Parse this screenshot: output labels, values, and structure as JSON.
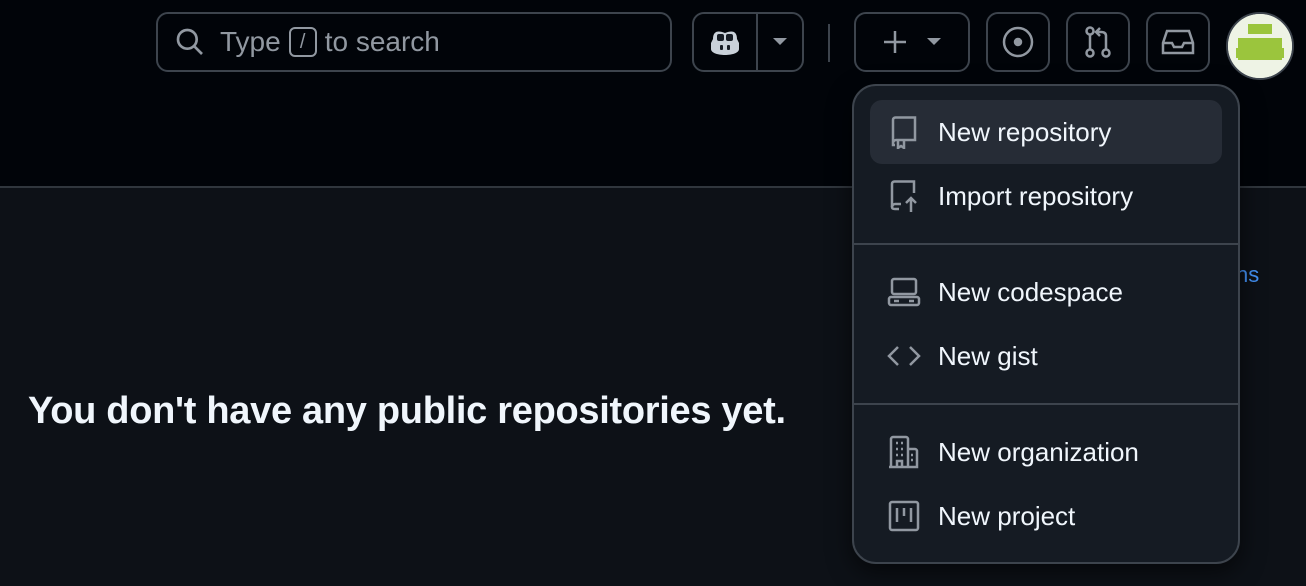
{
  "header": {
    "search": {
      "prefix": "Type",
      "key": "/",
      "suffix": "to search"
    }
  },
  "main": {
    "empty_message": "You don't have any public repositories yet.",
    "partial_link": "ns"
  },
  "create_menu": {
    "items": [
      {
        "label": "New repository",
        "icon": "repo-icon"
      },
      {
        "label": "Import repository",
        "icon": "repo-push-icon"
      },
      {
        "label": "New codespace",
        "icon": "codespace-icon"
      },
      {
        "label": "New gist",
        "icon": "code-icon"
      },
      {
        "label": "New organization",
        "icon": "organization-icon"
      },
      {
        "label": "New project",
        "icon": "project-icon"
      }
    ]
  },
  "colors": {
    "background": "#010409",
    "main_background": "#0d1117",
    "menu_background": "#151b23",
    "border": "#3d444d",
    "link": "#4493f8",
    "avatar": "#9bc53d"
  }
}
